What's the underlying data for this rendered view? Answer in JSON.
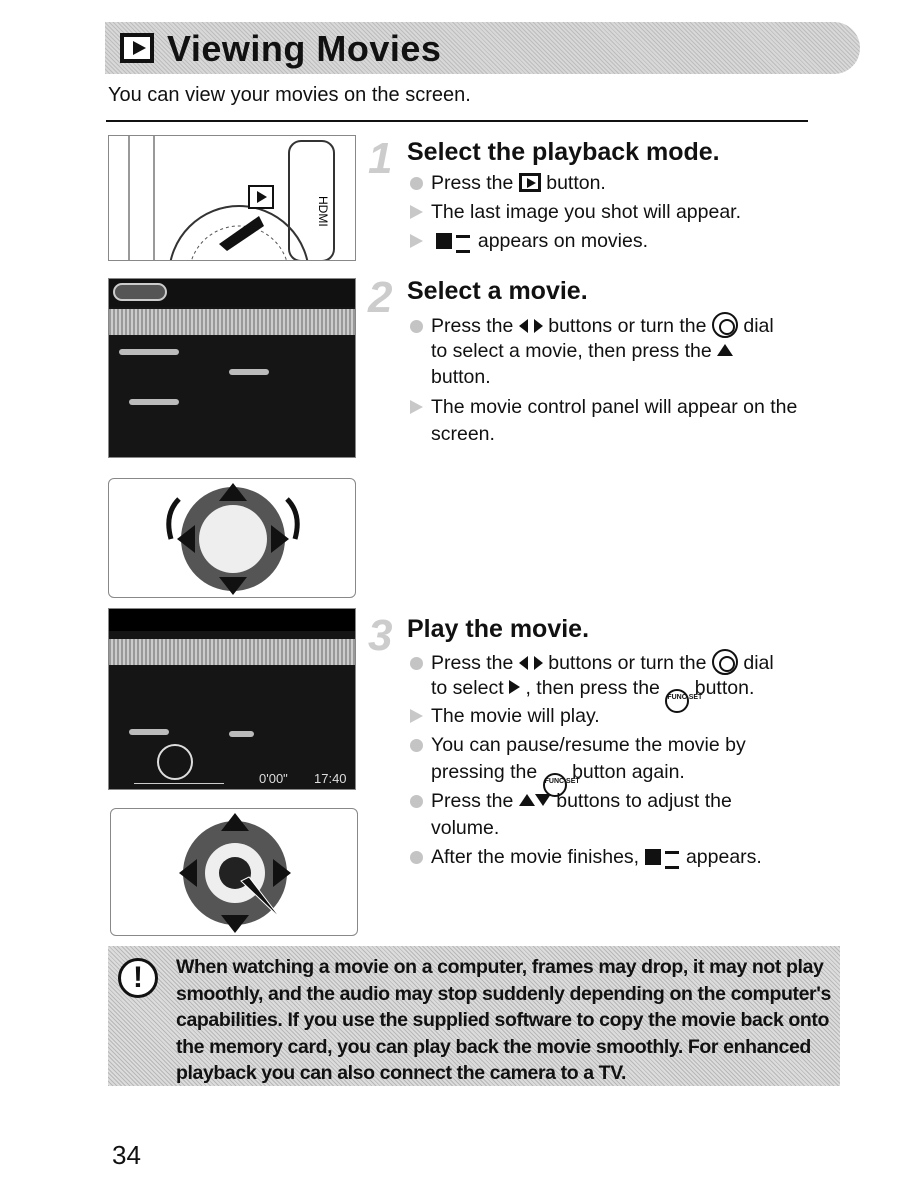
{
  "title": "Viewing Movies",
  "title_icon": "playback-icon",
  "intro": "You can view your movies on the screen.",
  "steps": [
    {
      "number": "1",
      "heading": "Select the playback mode.",
      "lines": [
        {
          "type": "action",
          "a": "Press the",
          "icon": "playback-icon",
          "b": "button."
        },
        {
          "type": "result",
          "a": "The last image you shot will appear."
        },
        {
          "type": "result",
          "icon": "movie-icon",
          "b": "appears on movies."
        }
      ]
    },
    {
      "number": "2",
      "heading": "Select a movie.",
      "lines": [
        {
          "type": "action",
          "a": "Press the",
          "icon": "left-right-arrows-icon",
          "b": "buttons or turn the",
          "icon2": "control-dial-icon",
          "c": "dial"
        },
        {
          "type": "cont",
          "a": "to select a movie, then press the",
          "icon": "up-arrow-icon"
        },
        {
          "type": "cont",
          "a": "button."
        },
        {
          "type": "result",
          "a": "The movie control panel will appear on the"
        },
        {
          "type": "cont",
          "a": "screen."
        }
      ]
    },
    {
      "number": "3",
      "heading": "Play the movie.",
      "lines": [
        {
          "type": "action",
          "a": "Press the",
          "icon": "left-right-arrows-icon",
          "b": "buttons or turn the",
          "icon2": "control-dial-icon",
          "c": "dial"
        },
        {
          "type": "cont",
          "a": "to select",
          "icon": "play-icon",
          "b": ", then press the",
          "icon2": "func-set-icon",
          "c": "button."
        },
        {
          "type": "result",
          "a": "The movie will play."
        },
        {
          "type": "action",
          "a": "You can pause/resume the movie by"
        },
        {
          "type": "cont",
          "a": "pressing the",
          "icon": "func-set-icon",
          "b": "button again."
        },
        {
          "type": "action",
          "a": "Press the",
          "icon": "up-down-arrows-icon",
          "b": "buttons to adjust the"
        },
        {
          "type": "cont",
          "a": "volume."
        },
        {
          "type": "action",
          "a": "After the movie finishes,",
          "icon": "movie-icon",
          "b": "appears."
        }
      ]
    }
  ],
  "func_label": "FUNC SET",
  "screen2": {
    "time_elapsed": "0'00\"",
    "time_total": "17:40"
  },
  "camera_label": "HDMI",
  "warning": "When watching a movie on a computer, frames may drop, it may not play smoothly, and the audio may stop suddenly depending on the computer's capabilities. If you use the supplied software to copy the movie back onto the memory card, you can play back the movie smoothly. For enhanced playback you can also connect the camera to a TV.",
  "page_number": "34"
}
